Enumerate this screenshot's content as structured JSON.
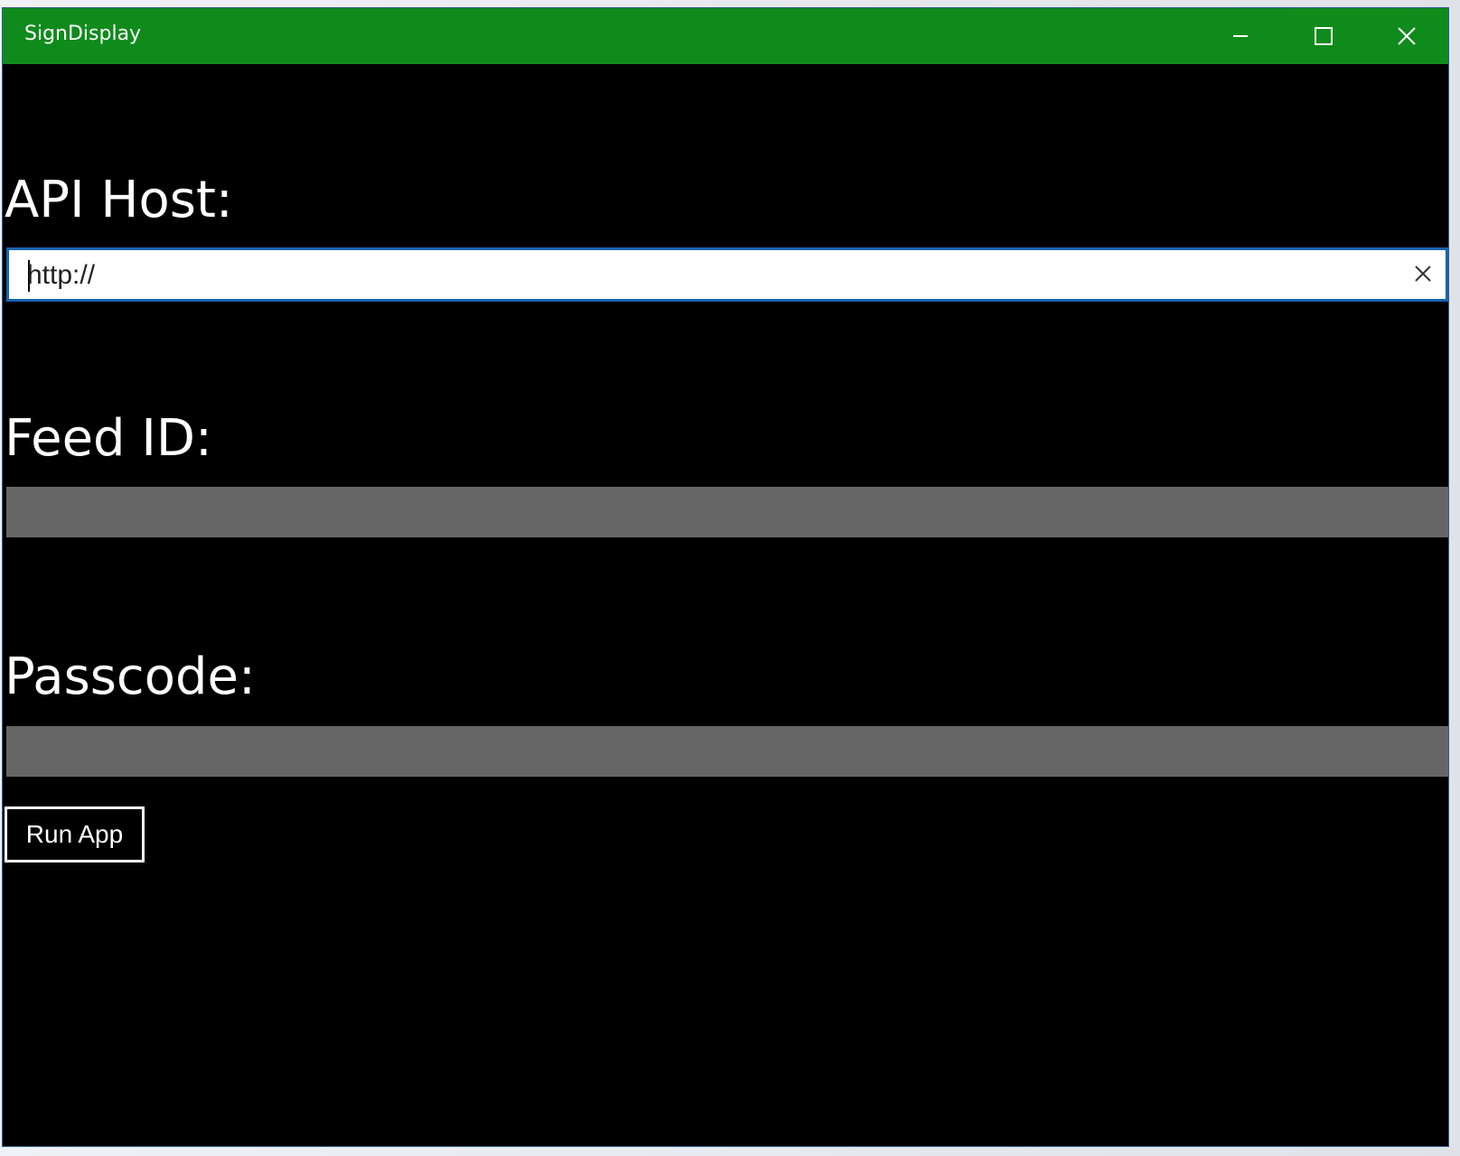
{
  "window": {
    "title": "SignDisplay",
    "controls": {
      "minimize_icon": "minimize-icon",
      "maximize_icon": "maximize-icon",
      "close_icon": "close-icon"
    },
    "colors": {
      "titlebar": "#0f8b1c",
      "background": "#000000",
      "input_border": "#1564b2",
      "empty_field": "#666666"
    }
  },
  "form": {
    "api_host": {
      "label": "API Host:",
      "value": "http://",
      "clear_icon": "clear-icon"
    },
    "feed_id": {
      "label": "Feed ID:",
      "value": ""
    },
    "passcode": {
      "label": "Passcode:",
      "value": ""
    },
    "run_button": {
      "label": "Run App"
    }
  }
}
